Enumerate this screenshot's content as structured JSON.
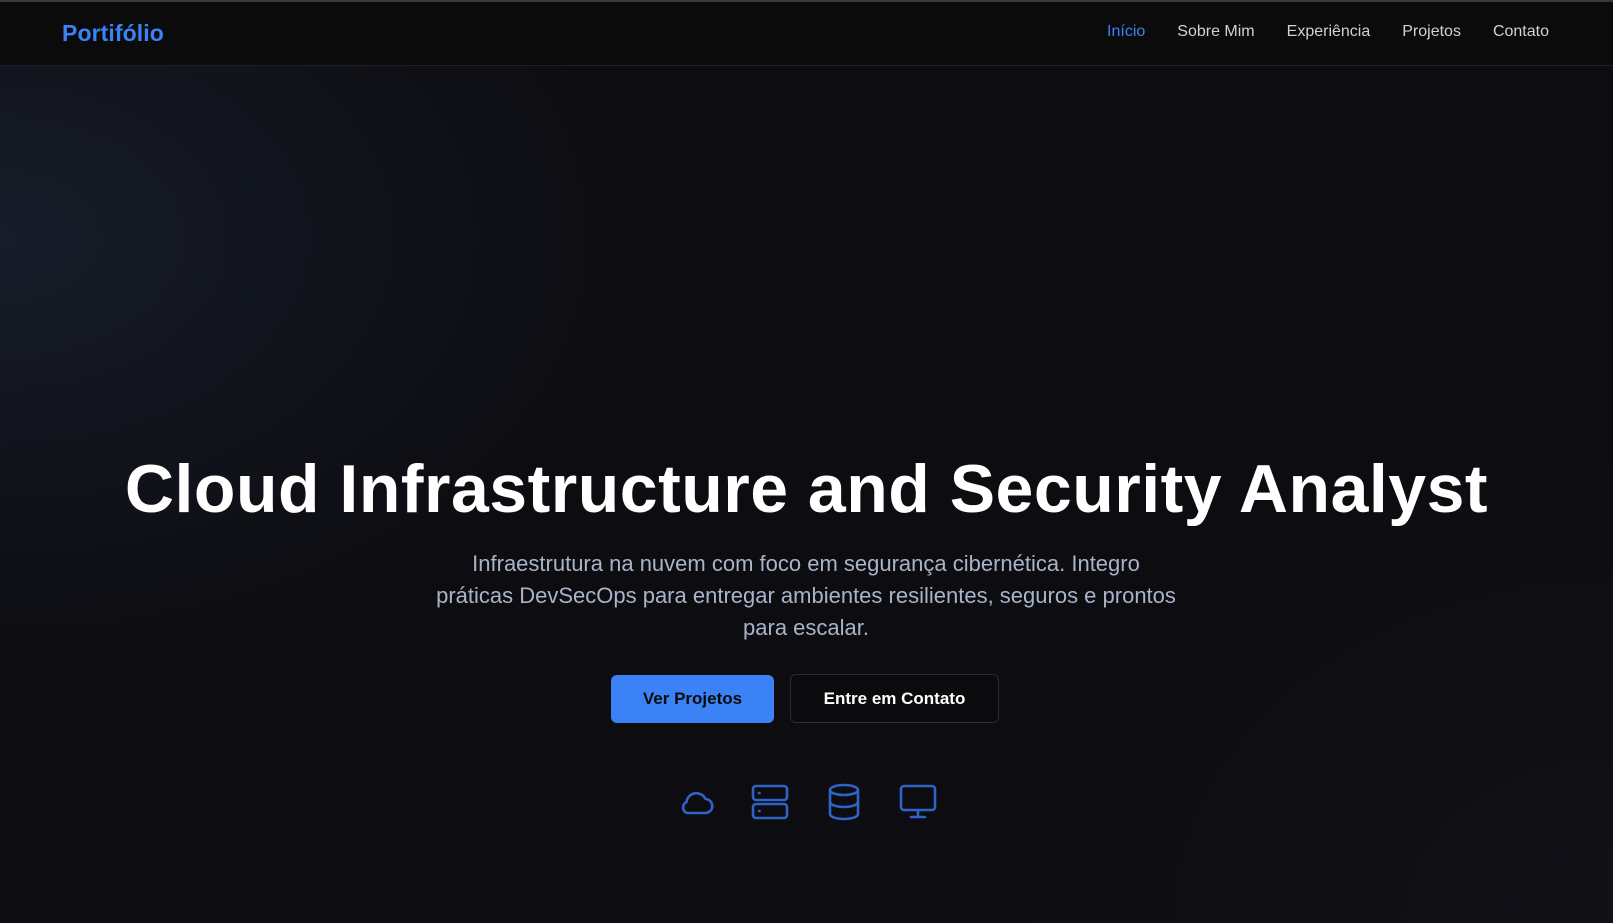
{
  "header": {
    "brand": "Portifólio",
    "nav": [
      {
        "label": "Início",
        "active": true
      },
      {
        "label": "Sobre Mim",
        "active": false
      },
      {
        "label": "Experiência",
        "active": false
      },
      {
        "label": "Projetos",
        "active": false
      },
      {
        "label": "Contato",
        "active": false
      }
    ]
  },
  "hero": {
    "title": "Cloud Infrastructure and Security Analyst",
    "subtitle": "Infraestrutura na nuvem com foco em segurança cibernética. Integro práticas DevSecOps para entregar ambientes resilientes, seguros e prontos para escalar.",
    "primary_button": "Ver Projetos",
    "secondary_button": "Entre em Contato",
    "icons": [
      "cloud-icon",
      "server-icon",
      "database-icon",
      "monitor-icon"
    ]
  },
  "colors": {
    "accent": "#3b82f6",
    "background": "#0c0c0f",
    "subtitle_text": "#a8b4c8"
  }
}
